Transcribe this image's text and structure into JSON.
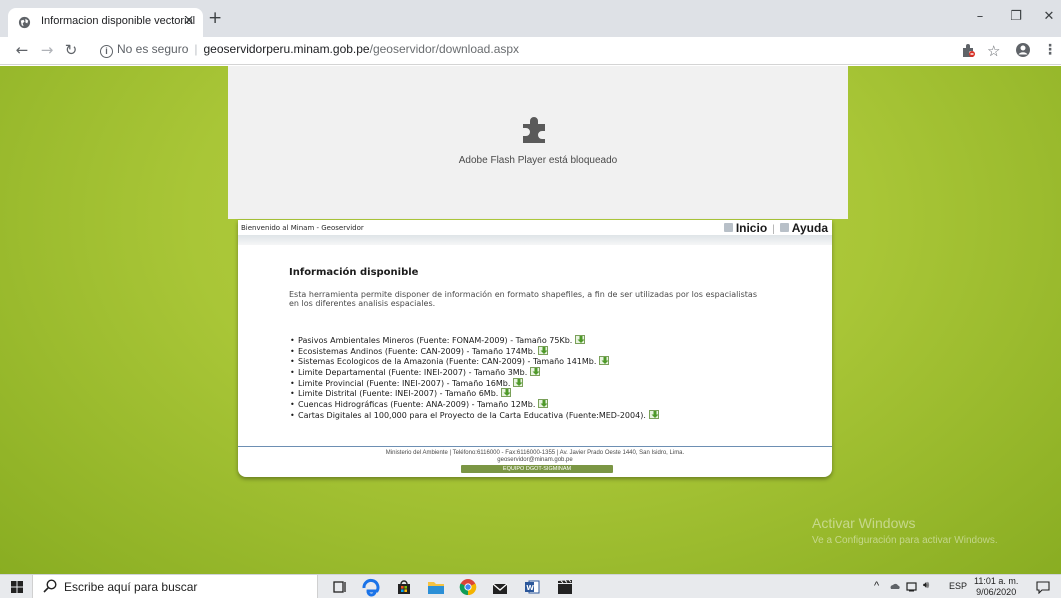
{
  "browser": {
    "tab_title": "Informacion disponible vectorial",
    "tab_close": "×",
    "new_tab": "+",
    "security_label": "No es seguro",
    "url_domain": "geoservidorperu.minam.gob.pe",
    "url_path": "/geoservidor/download.aspx",
    "window_controls": {
      "minimize": "–",
      "maximize": "❐",
      "close": "✕"
    }
  },
  "flash": {
    "message": "Adobe Flash Player está bloqueado"
  },
  "site": {
    "welcome": "Bienvenido al Minam - Geoservidor",
    "nav_home": "Inicio",
    "nav_separator": "|",
    "nav_help": "Ayuda",
    "section_title": "Información disponible",
    "intro": "Esta herramienta permite disponer de información en formato shapefiles, a fin de ser utilizadas por los espacialistas en los diferentes analisis espaciales.",
    "downloads": [
      {
        "label": "Pasivos Ambientales Mineros (Fuente: FONAM-2009) - Tamaño 75Kb."
      },
      {
        "label": "Ecosistemas Andinos (Fuente: CAN-2009) - Tamaño 174Mb."
      },
      {
        "label": "Sistemas Ecologicos de la Amazonia (Fuente: CAN-2009) - Tamaño 141Mb."
      },
      {
        "label": "Limite Departamental (Fuente: INEI-2007) - Tamaño 3Mb."
      },
      {
        "label": "Limite Provincial (Fuente: INEI-2007) - Tamaño 16Mb."
      },
      {
        "label": "Limite Distrital (Fuente: INEI-2007) - Tamaño 6Mb."
      },
      {
        "label": "Cuencas Hidrográficas (Fuente: ANA-2009) - Tamaño 12Mb."
      },
      {
        "label": "Cartas Digitales al 100,000 para el Proyecto de la Carta Educativa (Fuente:MED-2004)."
      }
    ],
    "footer_line1": "Ministerio del Ambiente | Teléfono:6116000 - Fax:6116000-1355 | Av. Javier Prado Oeste 1440, San Isidro, Lima.",
    "footer_line2": "geoservidor@minam.gob.pe",
    "footer_team": "EQUIPO DGOT-SIGMINAM"
  },
  "watermark": {
    "title": "Activar Windows",
    "subtitle": "Ve a Configuración para activar Windows."
  },
  "taskbar": {
    "search_placeholder": "Escribe aquí para buscar",
    "language": "ESP",
    "time": "11:01 a. m.",
    "date": "9/06/2020",
    "tray_chevron": "^",
    "tray_volume": "🔊︎"
  },
  "colors": {
    "page_green": "#a9c637",
    "flash_gray": "#f1f1f1",
    "footer_button": "#7b9644",
    "accent_blue": "#1a73e8"
  }
}
